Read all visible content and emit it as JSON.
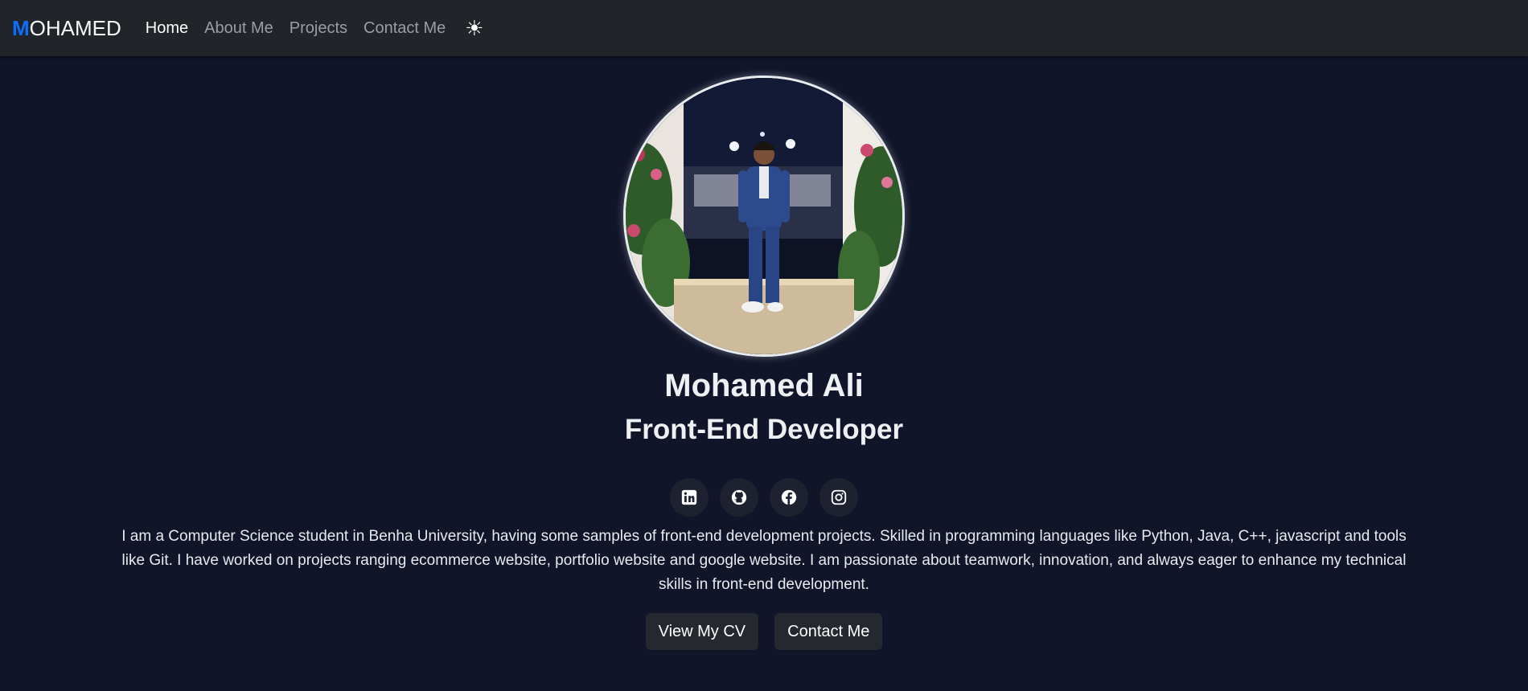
{
  "nav": {
    "brand_first": "M",
    "brand_rest": "OHAMED",
    "links": [
      {
        "label": "Home",
        "active": true
      },
      {
        "label": "About Me",
        "active": false
      },
      {
        "label": "Projects",
        "active": false
      },
      {
        "label": "Contact Me",
        "active": false
      }
    ],
    "theme_toggle_icon": "☀"
  },
  "hero": {
    "name": "Mohamed Ali",
    "role": "Front-End Developer",
    "socials": [
      "linkedin-icon",
      "github-icon",
      "facebook-icon",
      "instagram-icon"
    ],
    "bio": "I am a Computer Science student in Benha University, having some samples of front-end development projects. Skilled in programming languages like Python, Java, C++, javascript and tools like Git. I have worked on projects ranging ecommerce website, portfolio website and google website. I am passionate about teamwork, innovation, and always eager to enhance my technical skills in front-end development.",
    "buttons": {
      "cv": "View My CV",
      "contact": "Contact Me"
    }
  },
  "colors": {
    "background": "#10152a",
    "navbar": "#212529",
    "brand_accent": "#0d6efd",
    "button": "#25282e"
  }
}
